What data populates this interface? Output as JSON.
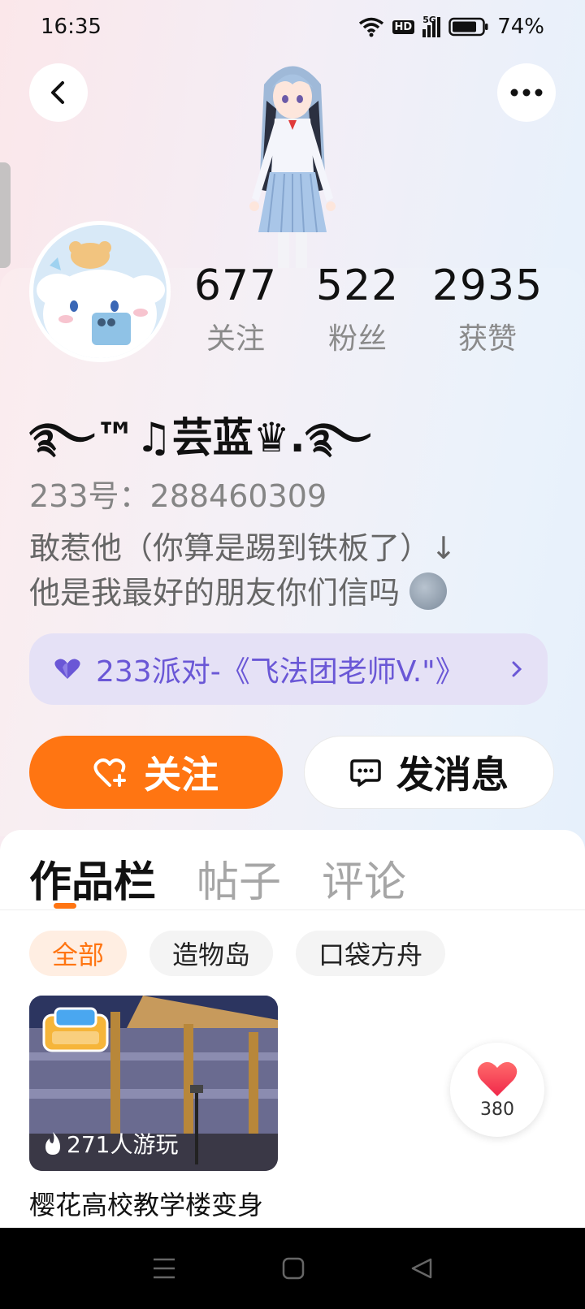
{
  "status": {
    "time": "16:35",
    "hd": "HD",
    "network": "5G",
    "battery": "74%"
  },
  "profile": {
    "nickname": "࿐™♫芸蓝♛.࿐",
    "uid": "233号：288460309",
    "bio_line1": "敢惹他（你算是踢到铁板了）↓",
    "bio_line2": "他是我最好的朋友你们信吗",
    "stats": [
      {
        "value": "677",
        "label": "关注"
      },
      {
        "value": "522",
        "label": "粉丝"
      },
      {
        "value": "2935",
        "label": "获赞"
      }
    ]
  },
  "party": {
    "text": "233派对-《飞法团老师V.\"》",
    "accent": "#6a57d6"
  },
  "actions": {
    "follow_label": "关注",
    "message_label": "发消息"
  },
  "tabs": [
    {
      "label": "作品栏",
      "active": true
    },
    {
      "label": "帖子",
      "active": false
    },
    {
      "label": "评论",
      "active": false
    }
  ],
  "filters": [
    {
      "label": "全部",
      "active": true
    },
    {
      "label": "造物岛",
      "active": false
    },
    {
      "label": "口袋方舟",
      "active": false
    }
  ],
  "games": [
    {
      "badge": "233造物岛",
      "plays": "271人游玩",
      "title": "樱花高校教学楼变身躲猫猫(测试版)"
    }
  ],
  "like_fab": {
    "count": "380"
  },
  "colors": {
    "brand": "#ff7512"
  }
}
